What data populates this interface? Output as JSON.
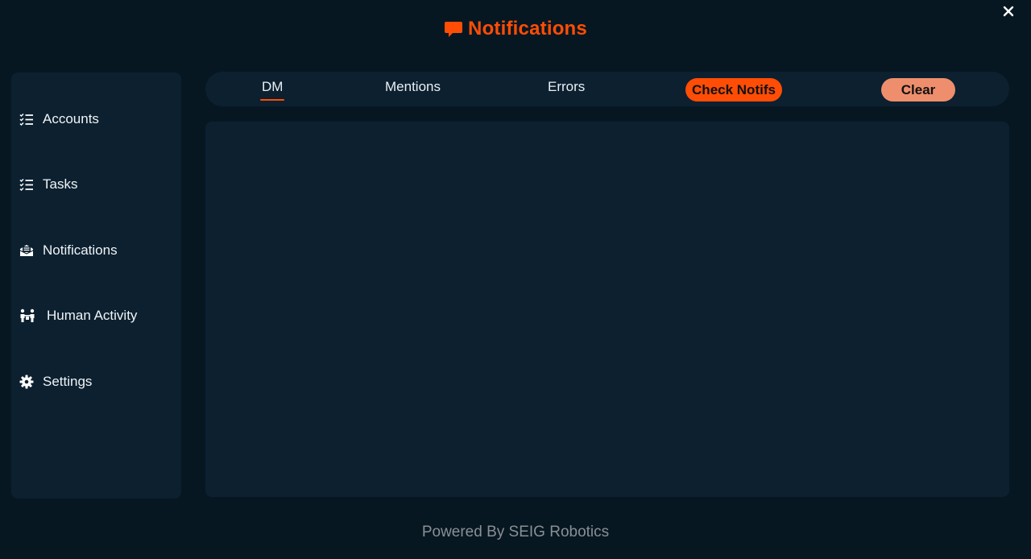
{
  "app": {
    "title": "Notifications",
    "title_icon": "chat-bubble-icon",
    "close_icon": "close-icon",
    "accent_color": "#ff4d05",
    "background_color": "#061722",
    "panel_color": "#0c2030"
  },
  "sidebar": {
    "items": [
      {
        "label": "Accounts",
        "icon": "checklist-icon"
      },
      {
        "label": "Tasks",
        "icon": "checklist-icon"
      },
      {
        "label": "Notifications",
        "icon": "envelope-open-icon"
      },
      {
        "label": "Human Activity",
        "icon": "people-icon"
      },
      {
        "label": "Settings",
        "icon": "gear-icon"
      }
    ]
  },
  "tabs": {
    "items": [
      {
        "label": "DM",
        "active": true
      },
      {
        "label": "Mentions",
        "active": false
      },
      {
        "label": "Errors",
        "active": false
      }
    ],
    "check_label": "Check Notifs",
    "clear_label": "Clear",
    "check_color": "#ff4d05",
    "clear_color": "#ef8e6c"
  },
  "footer": {
    "text": "Powered By SEIG Robotics"
  }
}
